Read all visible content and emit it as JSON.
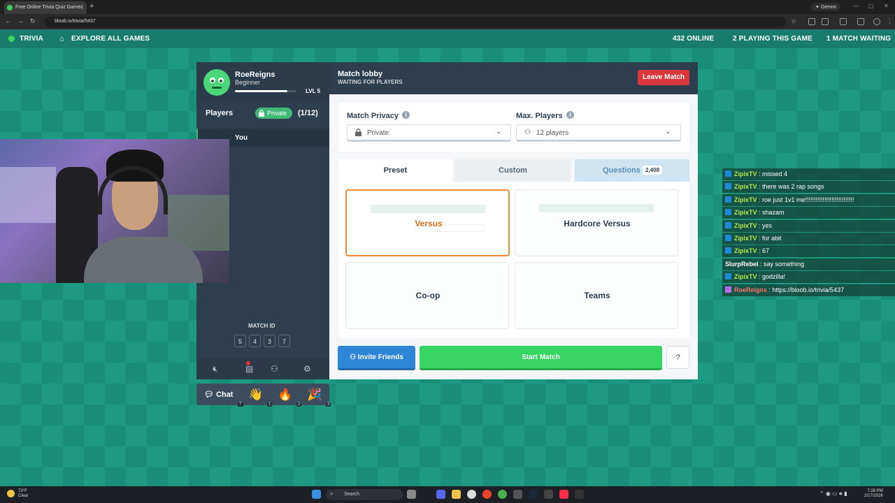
{
  "browser": {
    "tab_title": "Free Online Trivia Quiz Game |",
    "url": "bloob.io/trivia/5437",
    "gemini_label": "Gemini"
  },
  "topnav": {
    "app_name": "TRIVIA",
    "explore_label": "EXPLORE ALL GAMES",
    "online": "432 ONLINE",
    "playing": "2 PLAYING THIS GAME",
    "waiting": "1 MATCH WAITING"
  },
  "profile": {
    "username": "RoeReigns",
    "rank": "Beginner",
    "level": "LVL 5",
    "xp_fraction": 0.85
  },
  "players": {
    "label": "Players",
    "privacy": "Private",
    "count": "(1/12)",
    "you": "You"
  },
  "match_id": {
    "label": "MATCH ID",
    "digits": [
      "5",
      "4",
      "3",
      "7"
    ]
  },
  "chat_button": "Chat",
  "emotes": [
    {
      "glyph": "👋",
      "key": "1"
    },
    {
      "glyph": "🔥",
      "key": "2"
    },
    {
      "glyph": "🎉",
      "key": "3"
    }
  ],
  "chat_key": "T",
  "lobby": {
    "title": "Match lobby",
    "subtitle": "WAITING FOR PLAYERS",
    "leave_label": "Leave Match",
    "privacy_label": "Match Privacy",
    "privacy_value": "Private",
    "max_players_label": "Max. Players",
    "max_players_value": "12 players",
    "tabs": {
      "preset": "Preset",
      "custom": "Custom",
      "questions": "Questions",
      "questions_count": "2,408"
    },
    "modes": {
      "versus": "Versus",
      "hardcore": "Hardcore Versus",
      "coop": "Co-op",
      "teams": "Teams"
    },
    "invite_label": "Invite Friends",
    "start_label": "Start Match",
    "help_label": "?"
  },
  "chatlog": [
    {
      "user": "ZipixTV",
      "msg": " : missed 4",
      "color": "#b4e84a",
      "icon": true
    },
    {
      "user": "ZipixTV",
      "msg": " : there was 2 rap songs",
      "color": "#b4e84a",
      "icon": true
    },
    {
      "user": "ZipixTV",
      "msg": " : roe just 1v1 me!!!!!!!!!!!!!!!!!!!!!!!!!!!!",
      "color": "#b4e84a",
      "icon": true
    },
    {
      "user": "ZipixTV",
      "msg": " : shazam",
      "color": "#b4e84a",
      "icon": true
    },
    {
      "user": "ZipixTV",
      "msg": " : yes",
      "color": "#b4e84a",
      "icon": true
    },
    {
      "user": "ZipixTV",
      "msg": " : for abit",
      "color": "#b4e84a",
      "icon": true
    },
    {
      "user": "ZipixTV",
      "msg": " : 67",
      "color": "#b4e84a",
      "icon": true
    },
    {
      "user": "SlurpRebel",
      "msg": " : say something",
      "color": "#ffffff",
      "icon": false
    },
    {
      "user": "ZipixTV",
      "msg": " : godzilla!",
      "color": "#b4e84a",
      "icon": true
    },
    {
      "user": "RoeReigns",
      "msg": " : https://bloob.io/trivia/5437",
      "color": "#ff7070",
      "icon": true
    }
  ],
  "taskbar": {
    "weather_temp": "73°F",
    "weather_desc": "Clear",
    "search": "Search",
    "time": "7:28 PM",
    "date": "2/27/2026"
  },
  "colors": {
    "accent_green": "#36d463",
    "leave_red": "#d9373b",
    "invite_blue": "#2f86d8",
    "panel": "#2d3e4f"
  }
}
